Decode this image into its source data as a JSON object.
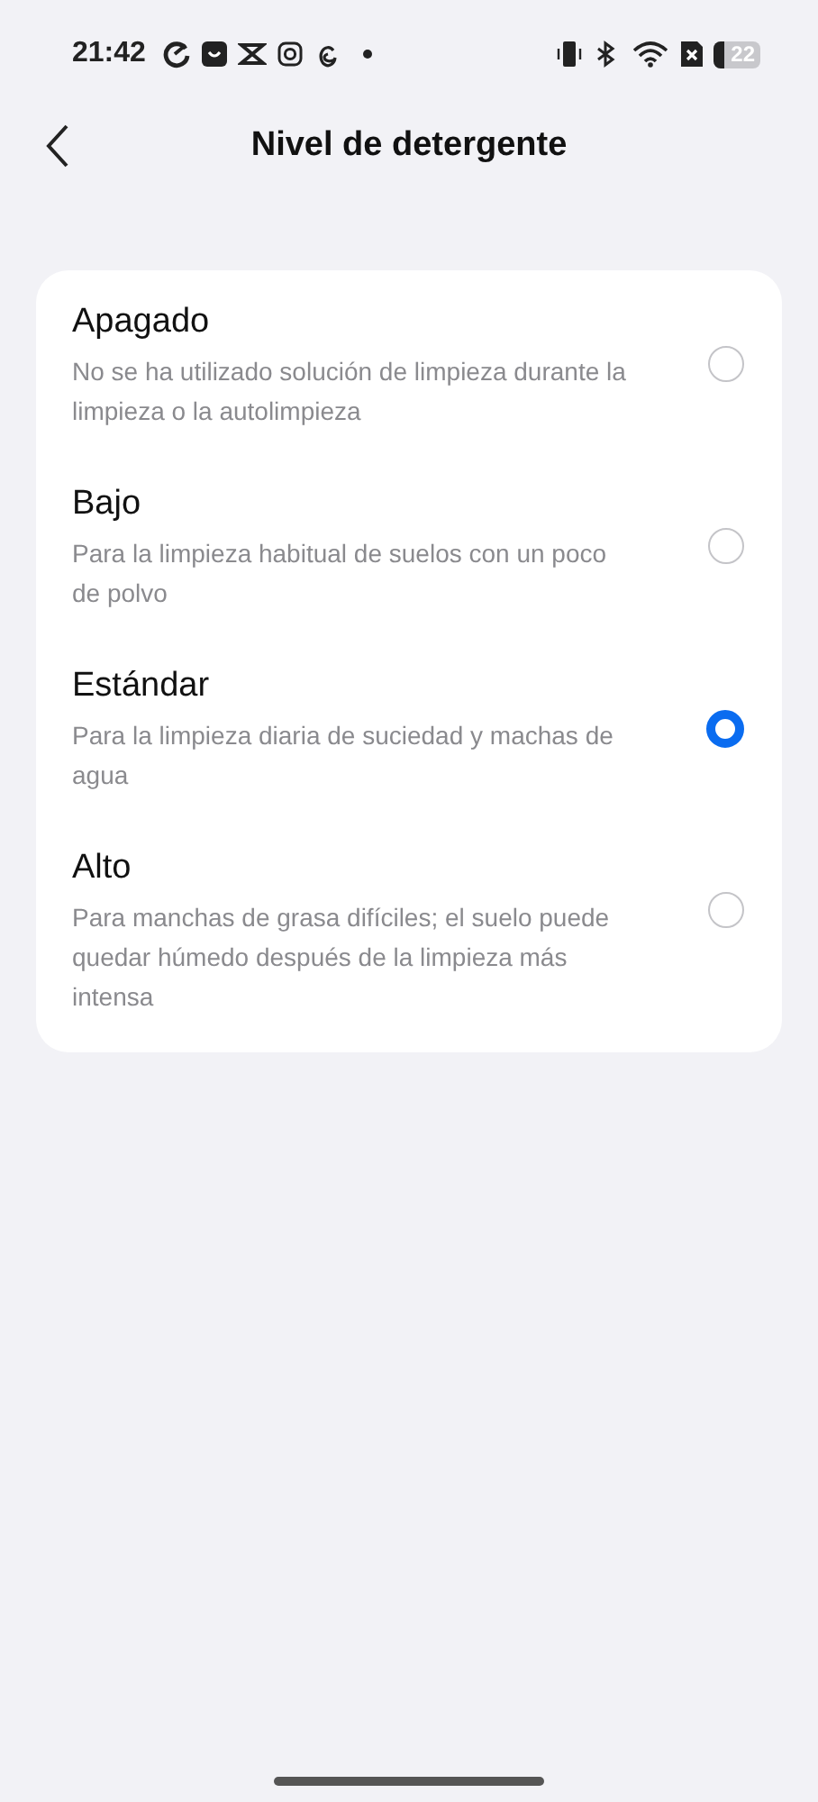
{
  "status_bar": {
    "time": "21:42",
    "battery": "22"
  },
  "header": {
    "title": "Nivel de detergente"
  },
  "options": [
    {
      "label": "Apagado",
      "description": "No se ha utilizado solución de limpieza durante la limpieza o la autolimpieza",
      "selected": false
    },
    {
      "label": "Bajo",
      "description": "Para la limpieza habitual de suelos con un poco de polvo",
      "selected": false
    },
    {
      "label": "Estándar",
      "description": "Para la limpieza diaria de suciedad y machas de agua",
      "selected": true
    },
    {
      "label": "Alto",
      "description": "Para manchas de grasa difíciles; el suelo puede quedar húmedo después de la limpieza más intensa",
      "selected": false
    }
  ]
}
